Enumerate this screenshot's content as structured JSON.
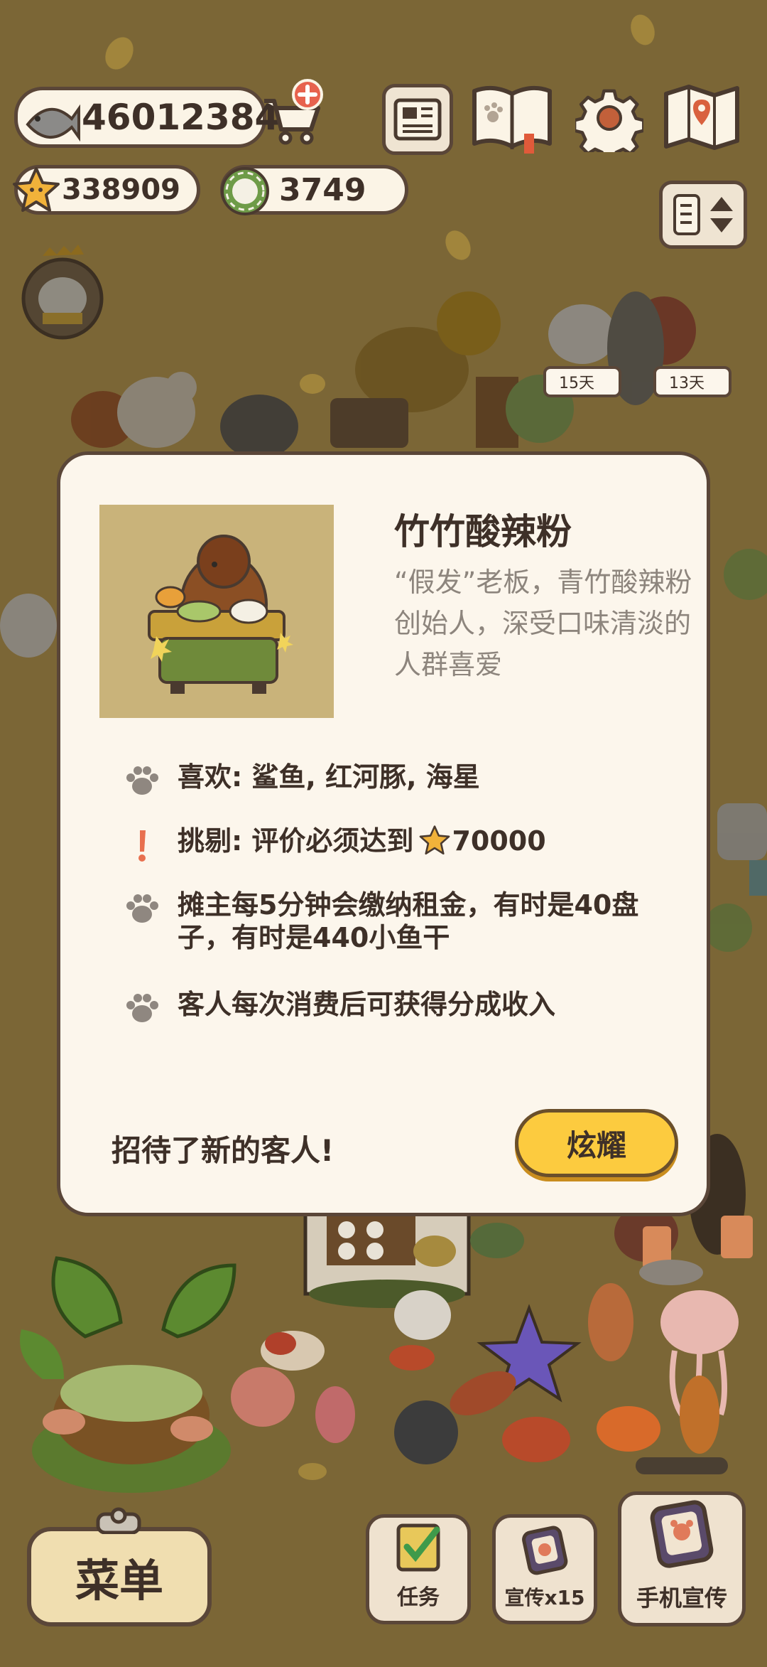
{
  "currency": {
    "fish": "46012384",
    "stars": "338909",
    "plates": "3749"
  },
  "npc_badges": [
    "15天",
    "13天"
  ],
  "dialog": {
    "title": "竹竹酸辣粉",
    "description": "“假发”老板，青竹酸辣粉创始人，深受口味清淡的人群喜爱",
    "likes": "喜欢: 鲨鱼, 红河豚, 海星",
    "picky_prefix": "挑剔: 评价必须达到",
    "picky_value": "70000",
    "rent": "摊主每5分钟会缴纳租金，有时是40盘子，有时是440小鱼干",
    "share": "客人每次消费后可获得分成收入",
    "footer": "招待了新的客人!",
    "show_button": "炫耀"
  },
  "bottom": {
    "menu": "菜单",
    "tasks": "任务",
    "promote": "宣传x15",
    "phone_promote": "手机宣传"
  },
  "colors": {
    "background": "#7b6636",
    "dialog_bg": "#fcf6ec",
    "button_yellow": "#fccb3f",
    "outline": "#5a4638"
  }
}
